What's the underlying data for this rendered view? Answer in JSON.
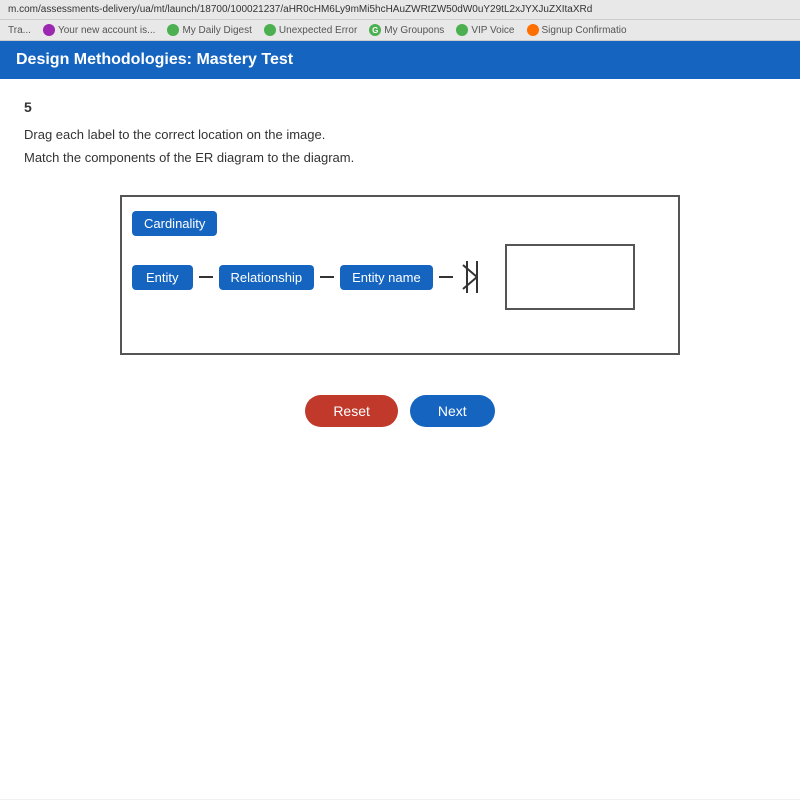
{
  "browser": {
    "url": "m.com/assessments-delivery/ua/mt/launch/18700/100021237/aHR0cHM6Ly9mMi5hcHAuZWRtZW50dW0uY29tL2xJYXJuZXItaXRd"
  },
  "tabs": [
    {
      "label": "Tra...",
      "icon": "none"
    },
    {
      "label": "Your new account is...",
      "icon": "purple"
    },
    {
      "label": "My Daily Digest",
      "icon": "green"
    },
    {
      "label": "Unexpected Error",
      "icon": "green"
    },
    {
      "label": "My Groupons",
      "icon": "green-g"
    },
    {
      "label": "VIP Voice",
      "icon": "green"
    },
    {
      "label": "Signup Confirmatio",
      "icon": "orange"
    }
  ],
  "header": {
    "title": "Design Methodologies: Mastery Test"
  },
  "question": {
    "number": "5",
    "instruction1": "Drag each label to the correct location on the image.",
    "instruction2": "Match the components of the ER diagram to the diagram."
  },
  "diagram": {
    "labels": {
      "cardinality": "Cardinality",
      "entity": "Entity",
      "relationship": "Relationship",
      "entity_name": "Entity name"
    }
  },
  "buttons": {
    "reset": "Reset",
    "next": "Next"
  }
}
